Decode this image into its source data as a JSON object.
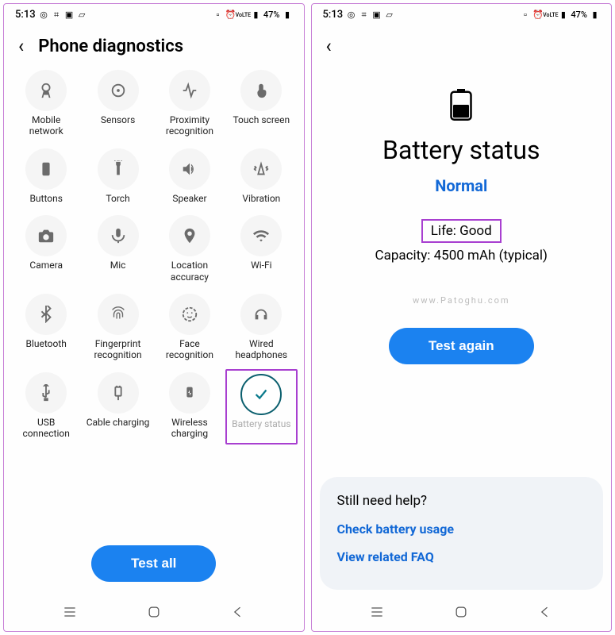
{
  "status": {
    "time": "5:13",
    "battery_pct": "47%",
    "net_label": "VoLTE"
  },
  "left": {
    "title": "Phone diagnostics",
    "test_all": "Test all",
    "tiles": [
      {
        "label": "Mobile network",
        "icon": "antenna"
      },
      {
        "label": "Sensors",
        "icon": "sensors"
      },
      {
        "label": "Proximity recognition",
        "icon": "proximity"
      },
      {
        "label": "Touch screen",
        "icon": "touch"
      },
      {
        "label": "Buttons",
        "icon": "buttons"
      },
      {
        "label": "Torch",
        "icon": "torch"
      },
      {
        "label": "Speaker",
        "icon": "speaker"
      },
      {
        "label": "Vibration",
        "icon": "vibration"
      },
      {
        "label": "Camera",
        "icon": "camera"
      },
      {
        "label": "Mic",
        "icon": "mic"
      },
      {
        "label": "Location accuracy",
        "icon": "location"
      },
      {
        "label": "Wi-Fi",
        "icon": "wifi"
      },
      {
        "label": "Bluetooth",
        "icon": "bluetooth"
      },
      {
        "label": "Fingerprint recognition",
        "icon": "fingerprint"
      },
      {
        "label": "Face recognition",
        "icon": "face"
      },
      {
        "label": "Wired headphones",
        "icon": "headphones"
      },
      {
        "label": "USB connection",
        "icon": "usb"
      },
      {
        "label": "Cable charging",
        "icon": "cable-charge"
      },
      {
        "label": "Wireless charging",
        "icon": "wireless-charge"
      },
      {
        "label": "Battery status",
        "icon": "check",
        "done": true,
        "highlight": true
      }
    ]
  },
  "right": {
    "title": "Battery status",
    "status": "Normal",
    "life": "Life: Good",
    "capacity": "Capacity: 4500 mAh (typical)",
    "watermark": "www.Patoghu.com",
    "test_again": "Test again",
    "help_title": "Still need help?",
    "help_links": [
      "Check battery usage",
      "View related FAQ"
    ]
  }
}
